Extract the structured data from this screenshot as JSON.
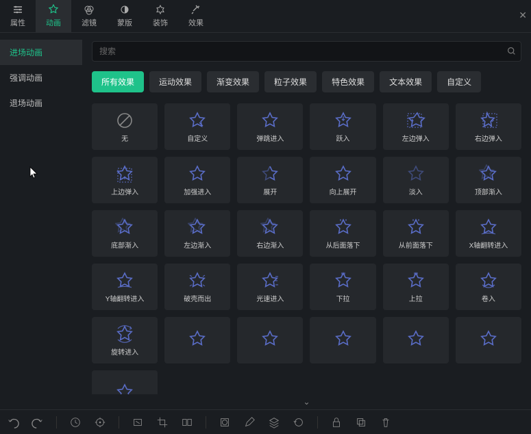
{
  "colors": {
    "accent": "#1fc28a",
    "bg": "#1a1d21",
    "panel": "#25282c",
    "star": "#5a6dc7"
  },
  "top_tabs": [
    {
      "id": "attributes",
      "label": "属性",
      "icon": "sliders"
    },
    {
      "id": "animation",
      "label": "动画",
      "icon": "star",
      "active": true
    },
    {
      "id": "filter",
      "label": "滤镜",
      "icon": "filter"
    },
    {
      "id": "mask",
      "label": "蒙版",
      "icon": "mask"
    },
    {
      "id": "decorate",
      "label": "装饰",
      "icon": "decorate"
    },
    {
      "id": "effect",
      "label": "效果",
      "icon": "sparkle"
    }
  ],
  "side_tabs": [
    {
      "id": "enter",
      "label": "进场动画",
      "active": true
    },
    {
      "id": "emph",
      "label": "强调动画"
    },
    {
      "id": "exit",
      "label": "退场动画"
    }
  ],
  "search": {
    "placeholder": "搜索"
  },
  "filters": [
    {
      "id": "all",
      "label": "所有效果",
      "active": true
    },
    {
      "id": "motion",
      "label": "运动效果"
    },
    {
      "id": "fade",
      "label": "渐变效果"
    },
    {
      "id": "particle",
      "label": "粒子效果"
    },
    {
      "id": "special",
      "label": "特色效果"
    },
    {
      "id": "text",
      "label": "文本效果"
    },
    {
      "id": "custom",
      "label": "自定义"
    }
  ],
  "effects": [
    {
      "id": "none",
      "label": "无",
      "icon": "forbid"
    },
    {
      "id": "custom",
      "label": "自定义",
      "icon": "star-edit"
    },
    {
      "id": "bounce-in",
      "label": "弹跳进入",
      "icon": "star"
    },
    {
      "id": "jump-in",
      "label": "跃入",
      "icon": "star-down"
    },
    {
      "id": "left-bounce",
      "label": "左边弹入",
      "icon": "star-right"
    },
    {
      "id": "right-bounce",
      "label": "右边弹入",
      "icon": "star-left"
    },
    {
      "id": "top-bounce",
      "label": "上边弹入",
      "icon": "star-up"
    },
    {
      "id": "strong-in",
      "label": "加强进入",
      "icon": "star"
    },
    {
      "id": "expand",
      "label": "展开",
      "icon": "star-split"
    },
    {
      "id": "expand-up",
      "label": "向上展开",
      "icon": "star"
    },
    {
      "id": "fade-in",
      "label": "淡入",
      "icon": "star-fade"
    },
    {
      "id": "fade-top",
      "label": "顶部渐入",
      "icon": "star-multi"
    },
    {
      "id": "fade-bottom",
      "label": "底部渐入",
      "icon": "star-multi"
    },
    {
      "id": "fade-left",
      "label": "左边渐入",
      "icon": "star-multi"
    },
    {
      "id": "fade-right",
      "label": "右边渐入",
      "icon": "star-multi"
    },
    {
      "id": "drop-back",
      "label": "从后面落下",
      "icon": "star-drop"
    },
    {
      "id": "drop-front",
      "label": "从前面落下",
      "icon": "star-drop"
    },
    {
      "id": "flip-x",
      "label": "X轴翻转进入",
      "icon": "star-flip"
    },
    {
      "id": "flip-y",
      "label": "Y轴翻转进入",
      "icon": "star-flip"
    },
    {
      "id": "break-out",
      "label": "破壳而出",
      "icon": "star-break"
    },
    {
      "id": "light-in",
      "label": "光速进入",
      "icon": "star-speed"
    },
    {
      "id": "pull-down",
      "label": "下拉",
      "icon": "star-pull"
    },
    {
      "id": "pull-up",
      "label": "上拉",
      "icon": "star-pull"
    },
    {
      "id": "roll-in",
      "label": "卷入",
      "icon": "star-roll"
    },
    {
      "id": "rotate-in",
      "label": "旋转进入",
      "icon": "star-rotate"
    },
    {
      "id": "extra-1",
      "label": "",
      "icon": "star"
    },
    {
      "id": "extra-2",
      "label": "",
      "icon": "star"
    },
    {
      "id": "extra-3",
      "label": "",
      "icon": "star"
    },
    {
      "id": "extra-4",
      "label": "",
      "icon": "star"
    },
    {
      "id": "extra-5",
      "label": "",
      "icon": "star"
    },
    {
      "id": "extra-6",
      "label": "",
      "icon": "star"
    }
  ],
  "bottom_icons": [
    "undo",
    "redo",
    "|",
    "history",
    "target",
    "|",
    "ratio",
    "crop",
    "compare",
    "|",
    "mask-sq",
    "edit",
    "layers",
    "rotate",
    "|",
    "lock",
    "copy",
    "trash"
  ]
}
